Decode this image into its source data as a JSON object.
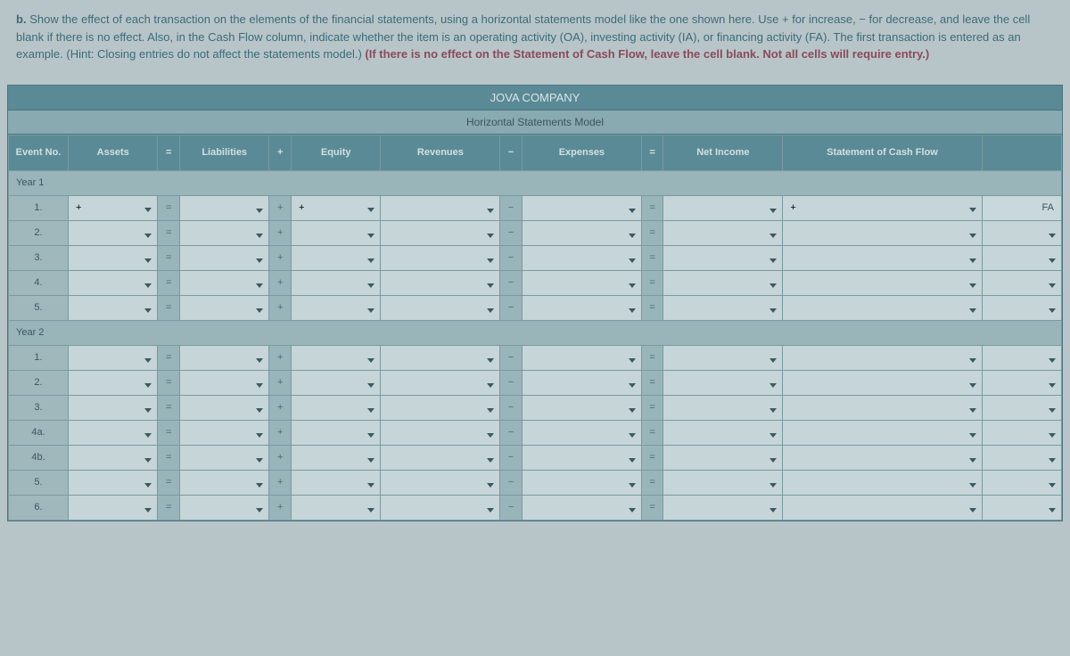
{
  "instructions": {
    "label": "b.",
    "text_main": "Show the effect of each transaction on the elements of the financial statements, using a horizontal statements model like the one shown here. Use + for increase, − for decrease, and leave the cell blank if there is no effect. Also, in the Cash Flow column, indicate whether the item is an operating activity (OA), investing activity (IA), or financing activity (FA). The first transaction is entered as an example. (Hint: Closing entries do not affect the statements model.)",
    "text_bold": "(If there is no effect on the Statement of Cash Flow, leave the cell blank. Not all cells will require entry.)"
  },
  "title": "JOVA COMPANY",
  "subtitle": "Horizontal Statements Model",
  "headers": {
    "event_no": "Event No.",
    "assets": "Assets",
    "eq": "=",
    "liabilities": "Liabilities",
    "plus": "+",
    "equity": "Equity",
    "revenues": "Revenues",
    "minus": "−",
    "expenses": "Expenses",
    "eq2": "=",
    "net_income": "Net Income",
    "cash_flow": "Statement of Cash Flow",
    "type": ""
  },
  "year1": {
    "label": "Year 1",
    "rows": [
      {
        "no": "1.",
        "assets": "+",
        "eq": "=",
        "plus": "+",
        "equity": "+",
        "minus": "−",
        "eq2": "=",
        "cash": "+",
        "type": "FA"
      },
      {
        "no": "2.",
        "eq": "=",
        "plus": "+",
        "minus": "−",
        "eq2": "="
      },
      {
        "no": "3.",
        "eq": "=",
        "plus": "+",
        "minus": "−",
        "eq2": "="
      },
      {
        "no": "4.",
        "eq": "=",
        "plus": "+",
        "minus": "−",
        "eq2": "="
      },
      {
        "no": "5.",
        "eq": "=",
        "plus": "+",
        "minus": "−",
        "eq2": "="
      }
    ]
  },
  "year2": {
    "label": "Year 2",
    "rows": [
      {
        "no": "1.",
        "eq": "=",
        "plus": "+",
        "minus": "−",
        "eq2": "="
      },
      {
        "no": "2.",
        "eq": "=",
        "plus": "+",
        "minus": "−",
        "eq2": "="
      },
      {
        "no": "3.",
        "eq": "=",
        "plus": "+",
        "minus": "−",
        "eq2": "="
      },
      {
        "no": "4a.",
        "eq": "=",
        "plus": "+",
        "minus": "−",
        "eq2": "="
      },
      {
        "no": "4b.",
        "eq": "=",
        "plus": "+",
        "minus": "−",
        "eq2": "="
      },
      {
        "no": "5.",
        "eq": "=",
        "plus": "+",
        "minus": "−",
        "eq2": "="
      },
      {
        "no": "6.",
        "eq": "=",
        "plus": "+",
        "minus": "−",
        "eq2": "="
      }
    ]
  }
}
